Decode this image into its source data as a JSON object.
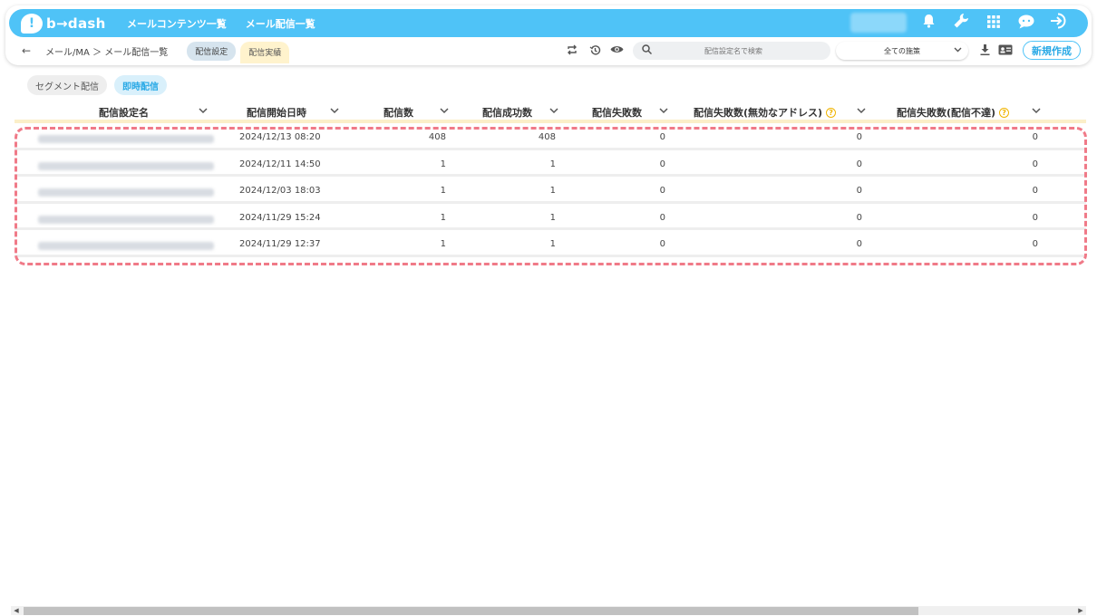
{
  "header": {
    "logo_mark": "!",
    "logo_text": "b→dash",
    "nav": [
      "メールコンテンツ一覧",
      "メール配信一覧"
    ],
    "icons": [
      "bell-icon",
      "wrench-icon",
      "grid-icon",
      "chat-icon",
      "logout-icon"
    ]
  },
  "subbar": {
    "back_glyph": "←",
    "breadcrumb": "メール/MA ＞ メール配信一覧",
    "tab_settings": "配信設定",
    "tab_results": "配信実績",
    "search_placeholder": "配信設定名で検索",
    "filter_selected": "全ての施策",
    "new_button": "新規作成"
  },
  "segment_tabs": {
    "segment": "セグメント配信",
    "instant": "即時配信"
  },
  "table": {
    "headers": [
      "配信設定名",
      "配信開始日時",
      "配信数",
      "配信成功数",
      "配信失敗数",
      "配信失敗数(無効なアドレス)",
      "配信失敗数(配信不達)"
    ],
    "rows": [
      {
        "start": "2024/12/13 08:20",
        "sent": "408",
        "success": "408",
        "fail": "0",
        "fail_invalid": "0",
        "fail_undelivered": "0"
      },
      {
        "start": "2024/12/11 14:50",
        "sent": "1",
        "success": "1",
        "fail": "0",
        "fail_invalid": "0",
        "fail_undelivered": "0"
      },
      {
        "start": "2024/12/03 18:03",
        "sent": "1",
        "success": "1",
        "fail": "0",
        "fail_invalid": "0",
        "fail_undelivered": "0"
      },
      {
        "start": "2024/11/29 15:24",
        "sent": "1",
        "success": "1",
        "fail": "0",
        "fail_invalid": "0",
        "fail_undelivered": "0"
      },
      {
        "start": "2024/11/29 12:37",
        "sent": "1",
        "success": "1",
        "fail": "0",
        "fail_invalid": "0",
        "fail_undelivered": "0"
      }
    ]
  },
  "colors": {
    "brand": "#4fc3f7",
    "highlight": "#f07a88",
    "header_rule": "#fbefc9"
  }
}
